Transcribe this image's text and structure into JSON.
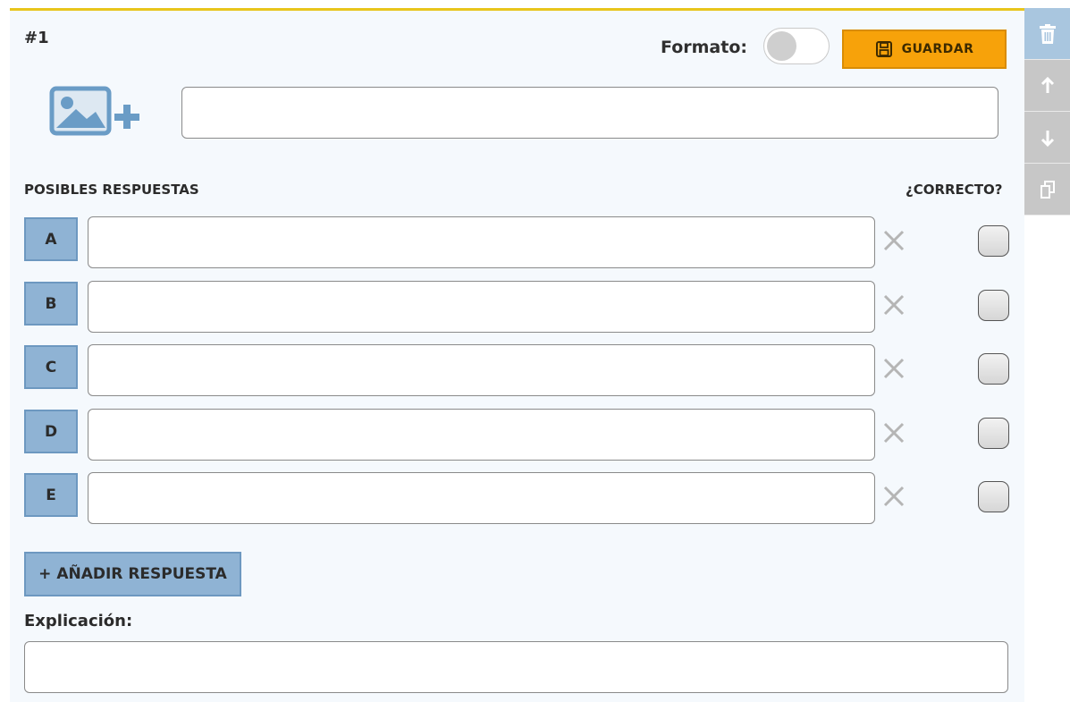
{
  "question": {
    "number": "#1",
    "format_label": "Formato:",
    "format_enabled": false,
    "save_label": "GUARDAR",
    "stem_value": ""
  },
  "answers": {
    "heading": "POSIBLES RESPUESTAS",
    "correct_heading": "¿CORRECTO?",
    "items": [
      {
        "letter": "A",
        "value": "",
        "correct": false
      },
      {
        "letter": "B",
        "value": "",
        "correct": false
      },
      {
        "letter": "C",
        "value": "",
        "correct": false
      },
      {
        "letter": "D",
        "value": "",
        "correct": false
      },
      {
        "letter": "E",
        "value": "",
        "correct": false
      }
    ],
    "add_label": "+ AÑADIR RESPUESTA"
  },
  "explanation": {
    "label": "Explicación:",
    "value": ""
  },
  "sidebar": {
    "buttons": [
      {
        "icon": "trash-icon",
        "active": true
      },
      {
        "icon": "arrow-up-icon",
        "active": false
      },
      {
        "icon": "arrow-down-icon",
        "active": false
      },
      {
        "icon": "duplicate-icon",
        "active": false
      }
    ]
  },
  "colors": {
    "accent_top": "#e8c51c",
    "save_button": "#f7a20a",
    "answer_letter": "#8fb3d4",
    "sidebar_active": "#a9c6df"
  }
}
